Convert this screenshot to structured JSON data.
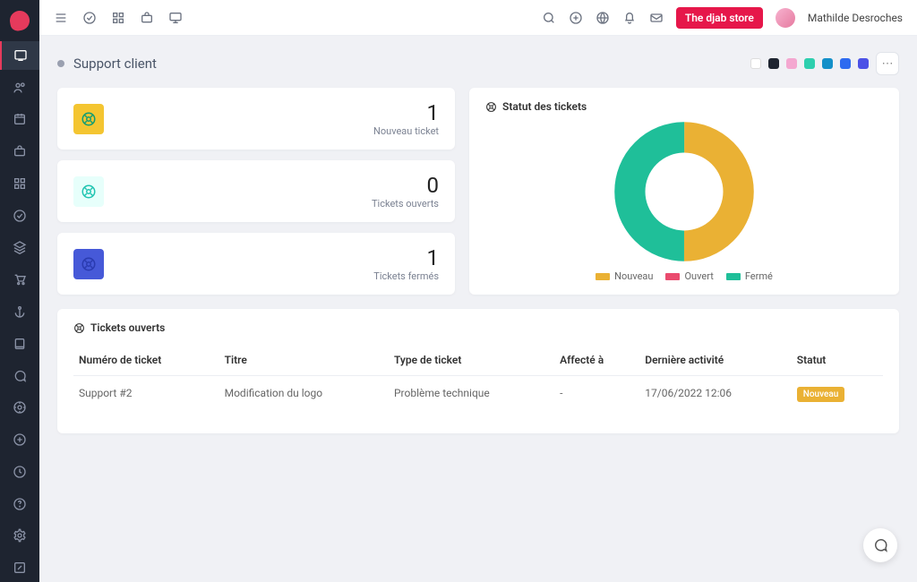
{
  "topbar": {
    "store_button": "The djab store",
    "username": "Mathilde Desroches"
  },
  "page": {
    "title": "Support client"
  },
  "swatches": [
    "#ffffff",
    "#1e2430",
    "#f4a7d0",
    "#2ecfae",
    "#1490c9",
    "#2e6bf0",
    "#4c52e6"
  ],
  "stats": [
    {
      "value": "1",
      "label": "Nouveau ticket",
      "bg": "#f4c531",
      "fg": "#0f9c74"
    },
    {
      "value": "0",
      "label": "Tickets ouverts",
      "bg": "#e7fffb",
      "fg": "#20c4b1"
    },
    {
      "value": "1",
      "label": "Tickets fermés",
      "bg": "#4659d8",
      "fg": "#2a3bb0"
    }
  ],
  "chart_title": "Statut des tickets",
  "chart_data": {
    "type": "pie",
    "title": "Statut des tickets",
    "series": [
      {
        "name": "Nouveau",
        "value": 1,
        "color": "#eab134"
      },
      {
        "name": "Ouvert",
        "value": 0,
        "color": "#ea4b6e"
      },
      {
        "name": "Fermé",
        "value": 1,
        "color": "#1fbf99"
      }
    ]
  },
  "tickets_table": {
    "title": "Tickets ouverts",
    "columns": [
      "Numéro de ticket",
      "Titre",
      "Type de ticket",
      "Affecté à",
      "Dernière activité",
      "Statut"
    ],
    "rows": [
      {
        "num": "Support #2",
        "title": "Modification du logo",
        "type": "Problème technique",
        "assignee": "-",
        "activity": "17/06/2022 12:06",
        "status": "Nouveau"
      }
    ]
  }
}
